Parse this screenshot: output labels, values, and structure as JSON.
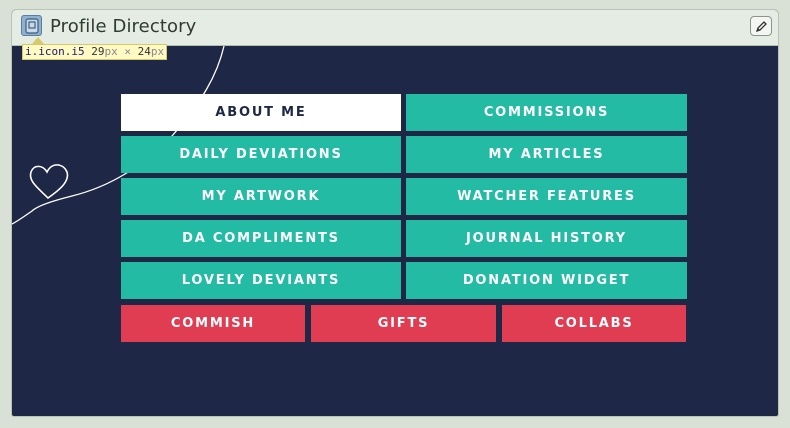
{
  "header": {
    "title": "Profile Directory",
    "icon": "app-icon",
    "edit_icon": "pencil-icon"
  },
  "tooltip": {
    "selector": "i.icon.i5",
    "width_value": "29",
    "height_value": "24",
    "unit": "px",
    "separator": "×"
  },
  "buttons": {
    "about_me": "ABOUT ME",
    "commissions": "COMMISSIONS",
    "daily_deviations": "DAILY DEVIATIONS",
    "my_articles": "MY ARTICLES",
    "my_artwork": "MY ARTWORK",
    "watcher_features": "WATCHER FEATURES",
    "da_compliments": "DA COMPLIMENTS",
    "journal_history": "JOURNAL HISTORY",
    "lovely_deviants": "LOVELY DEVIANTS",
    "donation_widget": "DONATION WIDGET",
    "commish": "COMMISH",
    "gifts": "GIFTS",
    "collabs": "COLLABS"
  },
  "colors": {
    "background": "#1e2745",
    "teal": "#24bba5",
    "red": "#e03c52",
    "white": "#ffffff"
  }
}
